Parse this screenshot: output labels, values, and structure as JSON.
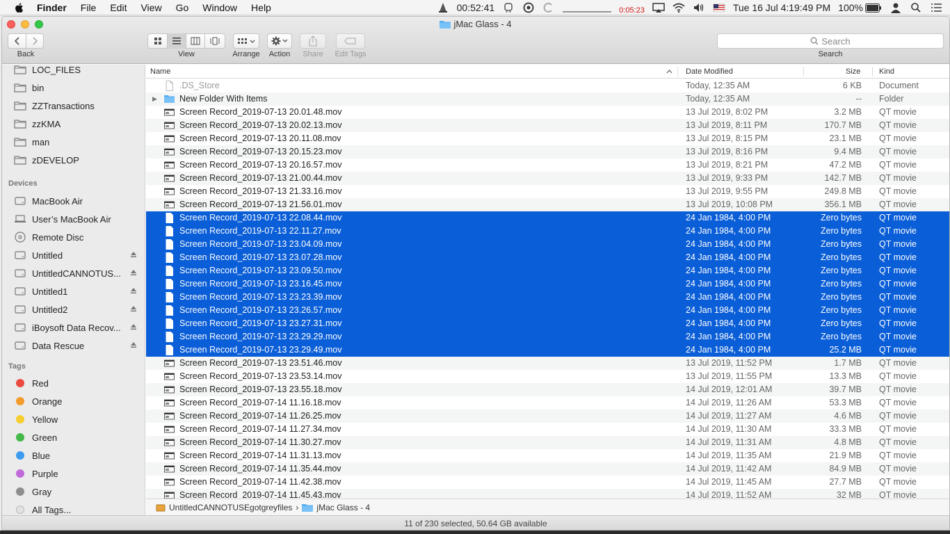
{
  "menubar": {
    "app_name": "Finder",
    "items": [
      "File",
      "Edit",
      "View",
      "Go",
      "Window",
      "Help"
    ],
    "timer": "00:52:41",
    "red_timer": "0:05:23",
    "datetime": "Tue 16 Jul  4:19:49 PM",
    "battery": "100%"
  },
  "window": {
    "title": "jMac Glass - 4",
    "toolbar": {
      "back_label": "Back",
      "view_label": "View",
      "arrange_label": "Arrange",
      "action_label": "Action",
      "share_label": "Share",
      "edit_tags_label": "Edit Tags",
      "search_placeholder": "Search",
      "search_label": "Search"
    }
  },
  "sidebar": {
    "favorites": [
      "LOC_FILES",
      "bin",
      "ZZTransactions",
      "zzKMA",
      "man",
      "zDEVELOP"
    ],
    "devices_header": "Devices",
    "devices": [
      {
        "label": "MacBook Air",
        "icon": "hard-drive-icon",
        "eject": false
      },
      {
        "label": "User’s MacBook Air",
        "icon": "laptop-icon",
        "eject": false
      },
      {
        "label": "Remote Disc",
        "icon": "disc-icon",
        "eject": false
      },
      {
        "label": "Untitled",
        "icon": "hard-drive-icon",
        "eject": true
      },
      {
        "label": "UntitledCANNOTUS...",
        "icon": "hard-drive-icon",
        "eject": true
      },
      {
        "label": "Untitled1",
        "icon": "hard-drive-icon",
        "eject": true
      },
      {
        "label": "Untitled2",
        "icon": "hard-drive-icon",
        "eject": true
      },
      {
        "label": "iBoysoft Data Recov...",
        "icon": "hard-drive-icon",
        "eject": true
      },
      {
        "label": "Data Rescue",
        "icon": "hard-drive-icon",
        "eject": true
      }
    ],
    "tags_header": "Tags",
    "tags": [
      {
        "label": "Red",
        "color": "#ec4a41"
      },
      {
        "label": "Orange",
        "color": "#f39c2c"
      },
      {
        "label": "Yellow",
        "color": "#f5cd2e"
      },
      {
        "label": "Green",
        "color": "#43b94a"
      },
      {
        "label": "Blue",
        "color": "#3d9bf0"
      },
      {
        "label": "Purple",
        "color": "#bf6ad8"
      },
      {
        "label": "Gray",
        "color": "#8e8e8e"
      },
      {
        "label": "All Tags...",
        "color": "#e2e2e2"
      }
    ]
  },
  "columns": {
    "name": "Name",
    "date": "Date Modified",
    "size": "Size",
    "kind": "Kind"
  },
  "files": [
    {
      "name": ".DS_Store",
      "date": "Today, 12:35 AM",
      "size": "6 KB",
      "kind": "Document",
      "selected": false,
      "type": "doc",
      "dim": true
    },
    {
      "name": "New Folder With Items",
      "date": "Today, 12:35 AM",
      "size": "--",
      "kind": "Folder",
      "selected": false,
      "type": "folder"
    },
    {
      "name": "Screen Record_2019-07-13 20.01.48.mov",
      "date": "13 Jul 2019, 8:02 PM",
      "size": "3.2 MB",
      "kind": "QT movie",
      "selected": false,
      "type": "movie"
    },
    {
      "name": "Screen Record_2019-07-13 20.02.13.mov",
      "date": "13 Jul 2019, 8:11 PM",
      "size": "170.7 MB",
      "kind": "QT movie",
      "selected": false,
      "type": "movie"
    },
    {
      "name": "Screen Record_2019-07-13 20.11.08.mov",
      "date": "13 Jul 2019, 8:15 PM",
      "size": "23.1 MB",
      "kind": "QT movie",
      "selected": false,
      "type": "movie"
    },
    {
      "name": "Screen Record_2019-07-13 20.15.23.mov",
      "date": "13 Jul 2019, 8:16 PM",
      "size": "9.4 MB",
      "kind": "QT movie",
      "selected": false,
      "type": "movie"
    },
    {
      "name": "Screen Record_2019-07-13 20.16.57.mov",
      "date": "13 Jul 2019, 8:21 PM",
      "size": "47.2 MB",
      "kind": "QT movie",
      "selected": false,
      "type": "movie"
    },
    {
      "name": "Screen Record_2019-07-13 21.00.44.mov",
      "date": "13 Jul 2019, 9:33 PM",
      "size": "142.7 MB",
      "kind": "QT movie",
      "selected": false,
      "type": "movie"
    },
    {
      "name": "Screen Record_2019-07-13 21.33.16.mov",
      "date": "13 Jul 2019, 9:55 PM",
      "size": "249.8 MB",
      "kind": "QT movie",
      "selected": false,
      "type": "movie"
    },
    {
      "name": "Screen Record_2019-07-13 21.56.01.mov",
      "date": "13 Jul 2019, 10:08 PM",
      "size": "356.1 MB",
      "kind": "QT movie",
      "selected": false,
      "type": "movie"
    },
    {
      "name": "Screen Record_2019-07-13 22.08.44.mov",
      "date": "24 Jan 1984, 4:00 PM",
      "size": "Zero bytes",
      "kind": "QT movie",
      "selected": true,
      "type": "doc"
    },
    {
      "name": "Screen Record_2019-07-13 22.11.27.mov",
      "date": "24 Jan 1984, 4:00 PM",
      "size": "Zero bytes",
      "kind": "QT movie",
      "selected": true,
      "type": "doc"
    },
    {
      "name": "Screen Record_2019-07-13 23.04.09.mov",
      "date": "24 Jan 1984, 4:00 PM",
      "size": "Zero bytes",
      "kind": "QT movie",
      "selected": true,
      "type": "doc"
    },
    {
      "name": "Screen Record_2019-07-13 23.07.28.mov",
      "date": "24 Jan 1984, 4:00 PM",
      "size": "Zero bytes",
      "kind": "QT movie",
      "selected": true,
      "type": "doc"
    },
    {
      "name": "Screen Record_2019-07-13 23.09.50.mov",
      "date": "24 Jan 1984, 4:00 PM",
      "size": "Zero bytes",
      "kind": "QT movie",
      "selected": true,
      "type": "doc"
    },
    {
      "name": "Screen Record_2019-07-13 23.16.45.mov",
      "date": "24 Jan 1984, 4:00 PM",
      "size": "Zero bytes",
      "kind": "QT movie",
      "selected": true,
      "type": "doc"
    },
    {
      "name": "Screen Record_2019-07-13 23.23.39.mov",
      "date": "24 Jan 1984, 4:00 PM",
      "size": "Zero bytes",
      "kind": "QT movie",
      "selected": true,
      "type": "doc"
    },
    {
      "name": "Screen Record_2019-07-13 23.26.57.mov",
      "date": "24 Jan 1984, 4:00 PM",
      "size": "Zero bytes",
      "kind": "QT movie",
      "selected": true,
      "type": "doc"
    },
    {
      "name": "Screen Record_2019-07-13 23.27.31.mov",
      "date": "24 Jan 1984, 4:00 PM",
      "size": "Zero bytes",
      "kind": "QT movie",
      "selected": true,
      "type": "doc"
    },
    {
      "name": "Screen Record_2019-07-13 23.29.29.mov",
      "date": "24 Jan 1984, 4:00 PM",
      "size": "Zero bytes",
      "kind": "QT movie",
      "selected": true,
      "type": "doc"
    },
    {
      "name": "Screen Record_2019-07-13 23.29.49.mov",
      "date": "24 Jan 1984, 4:00 PM",
      "size": "25.2 MB",
      "kind": "QT movie",
      "selected": true,
      "type": "doc"
    },
    {
      "name": "Screen Record_2019-07-13 23.51.46.mov",
      "date": "13 Jul 2019, 11:52 PM",
      "size": "1.7 MB",
      "kind": "QT movie",
      "selected": false,
      "type": "movie"
    },
    {
      "name": "Screen Record_2019-07-13 23.53.14.mov",
      "date": "13 Jul 2019, 11:55 PM",
      "size": "13.3 MB",
      "kind": "QT movie",
      "selected": false,
      "type": "movie"
    },
    {
      "name": "Screen Record_2019-07-13 23.55.18.mov",
      "date": "14 Jul 2019, 12:01 AM",
      "size": "39.7 MB",
      "kind": "QT movie",
      "selected": false,
      "type": "movie"
    },
    {
      "name": "Screen Record_2019-07-14 11.16.18.mov",
      "date": "14 Jul 2019, 11:26 AM",
      "size": "53.3 MB",
      "kind": "QT movie",
      "selected": false,
      "type": "movie"
    },
    {
      "name": "Screen Record_2019-07-14 11.26.25.mov",
      "date": "14 Jul 2019, 11:27 AM",
      "size": "4.6 MB",
      "kind": "QT movie",
      "selected": false,
      "type": "movie"
    },
    {
      "name": "Screen Record_2019-07-14 11.27.34.mov",
      "date": "14 Jul 2019, 11:30 AM",
      "size": "33.3 MB",
      "kind": "QT movie",
      "selected": false,
      "type": "movie"
    },
    {
      "name": "Screen Record_2019-07-14 11.30.27.mov",
      "date": "14 Jul 2019, 11:31 AM",
      "size": "4.8 MB",
      "kind": "QT movie",
      "selected": false,
      "type": "movie"
    },
    {
      "name": "Screen Record_2019-07-14 11.31.13.mov",
      "date": "14 Jul 2019, 11:35 AM",
      "size": "21.9 MB",
      "kind": "QT movie",
      "selected": false,
      "type": "movie"
    },
    {
      "name": "Screen Record_2019-07-14 11.35.44.mov",
      "date": "14 Jul 2019, 11:42 AM",
      "size": "84.9 MB",
      "kind": "QT movie",
      "selected": false,
      "type": "movie"
    },
    {
      "name": "Screen Record_2019-07-14 11.42.38.mov",
      "date": "14 Jul 2019, 11:45 AM",
      "size": "27.7 MB",
      "kind": "QT movie",
      "selected": false,
      "type": "movie"
    },
    {
      "name": "Screen Record_2019-07-14 11.45.43.mov",
      "date": "14 Jul 2019, 11:52 AM",
      "size": "32 MB",
      "kind": "QT movie",
      "selected": false,
      "type": "movie"
    }
  ],
  "pathbar": {
    "volume": "UntitledCANNOTUSEgotgreyfiles",
    "separator": "›",
    "folder": "jMac Glass - 4"
  },
  "status": "11 of 230 selected, 50.64 GB available"
}
